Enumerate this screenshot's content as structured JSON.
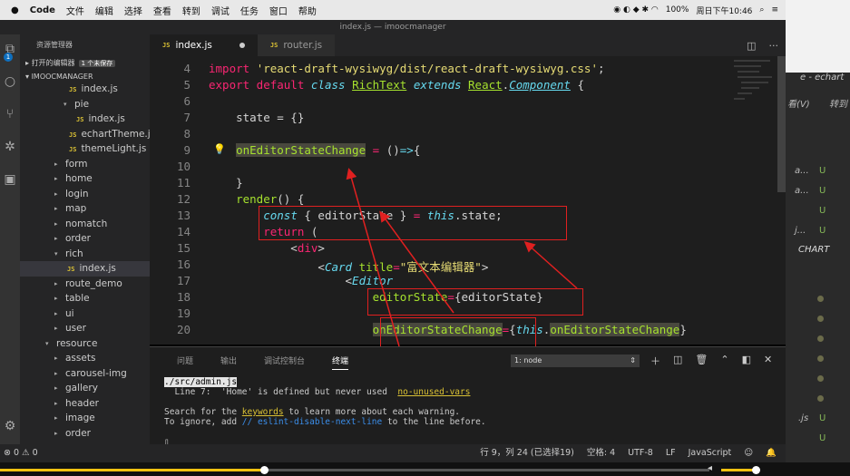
{
  "menubar": {
    "app": "Code",
    "items": [
      "文件",
      "编辑",
      "选择",
      "查看",
      "转到",
      "调试",
      "任务",
      "窗口",
      "帮助"
    ],
    "battery": "100%",
    "clock": "周日下午10:46"
  },
  "window_title": "index.js — imoocmanager",
  "sidebar": {
    "header": "资源管理器",
    "open_editors": "打开的编辑器",
    "unsaved_badge": "1 个未保存",
    "project": "IMOOCMANAGER",
    "badge_count": "1",
    "tree": [
      {
        "label": "index.js",
        "type": "js",
        "indent": 60
      },
      {
        "label": "pie",
        "type": "folder-open",
        "indent": 60
      },
      {
        "label": "index.js",
        "type": "js",
        "indent": 68
      },
      {
        "label": "echartTheme.js",
        "type": "js",
        "indent": 60
      },
      {
        "label": "themeLight.js",
        "type": "js",
        "indent": 60
      },
      {
        "label": "form",
        "type": "folder",
        "indent": 50
      },
      {
        "label": "home",
        "type": "folder",
        "indent": 50
      },
      {
        "label": "login",
        "type": "folder",
        "indent": 50
      },
      {
        "label": "map",
        "type": "folder",
        "indent": 50
      },
      {
        "label": "nomatch",
        "type": "folder",
        "indent": 50
      },
      {
        "label": "order",
        "type": "folder",
        "indent": 50
      },
      {
        "label": "rich",
        "type": "folder-open",
        "indent": 50
      },
      {
        "label": "index.js",
        "type": "js",
        "indent": 58,
        "selected": true
      },
      {
        "label": "route_demo",
        "type": "folder",
        "indent": 50
      },
      {
        "label": "table",
        "type": "folder",
        "indent": 50
      },
      {
        "label": "ui",
        "type": "folder",
        "indent": 50
      },
      {
        "label": "user",
        "type": "folder",
        "indent": 50
      },
      {
        "label": "resource",
        "type": "folder-open",
        "indent": 40
      },
      {
        "label": "assets",
        "type": "folder",
        "indent": 50
      },
      {
        "label": "carousel-img",
        "type": "folder",
        "indent": 50
      },
      {
        "label": "gallery",
        "type": "folder",
        "indent": 50
      },
      {
        "label": "header",
        "type": "folder",
        "indent": 50
      },
      {
        "label": "image",
        "type": "folder",
        "indent": 50
      },
      {
        "label": "order",
        "type": "folder",
        "indent": 50
      }
    ]
  },
  "tabs": [
    {
      "label": "index.js",
      "active": true,
      "dirty": true
    },
    {
      "label": "router.js",
      "active": false
    }
  ],
  "editor": {
    "lines": [
      {
        "n": "4",
        "html": "<span class=\"kw\">import</span> <span class=\"st\">'react-draft-wysiwyg/dist/react-draft-wysiwyg.css'</span>;"
      },
      {
        "n": "5",
        "html": "<span class=\"kw\">export default</span> <span class=\"it\">class</span> <span class=\"cls\">RichText</span> <span class=\"it\">extends</span> <span class=\"cls\">React</span>.<span class=\"cls it\">Component</span> {"
      },
      {
        "n": "6",
        "html": ""
      },
      {
        "n": "7",
        "html": "    state = {}"
      },
      {
        "n": "8",
        "html": ""
      },
      {
        "n": "9",
        "html": "    <span class=\"fn hl\">onEditorStateChange</span> <span class=\"kw\">=</span> ()<span class=\"it\">=&gt;</span>{"
      },
      {
        "n": "10",
        "html": ""
      },
      {
        "n": "11",
        "html": "    }"
      },
      {
        "n": "12",
        "html": "    <span class=\"fn\">render</span>() {"
      },
      {
        "n": "13",
        "html": "        <span class=\"it\">const</span> { editorState } <span class=\"kw\">=</span> <span class=\"it\">this</span>.state;"
      },
      {
        "n": "14",
        "html": "        <span class=\"kw\">return</span> ("
      },
      {
        "n": "15",
        "html": "            &lt;<span class=\"tg\">div</span>&gt;"
      },
      {
        "n": "16",
        "html": "                &lt;<span class=\"it\">Card</span> <span class=\"at\">title</span><span class=\"kw\">=</span><span class=\"st\">\"富文本编辑器\"</span>&gt;"
      },
      {
        "n": "17",
        "html": "                    &lt;<span class=\"it\">Editor</span>"
      },
      {
        "n": "18",
        "html": "                        <span class=\"at\">editorState</span><span class=\"kw\">=</span>{editorState}"
      },
      {
        "n": "19",
        "html": ""
      },
      {
        "n": "20",
        "html": "                        <span class=\"at hl\">onEditorStateChange</span><span class=\"kw\">=</span>{<span class=\"it\">this</span>.<span class=\"fn hl\">onEditorStateChange</span>}"
      }
    ]
  },
  "panel": {
    "tabs": [
      "问题",
      "输出",
      "调试控制台",
      "终端"
    ],
    "terminal_select": "1: node",
    "lines": [
      {
        "html": "<span class=\"path\">./src/admin.js</span>"
      },
      {
        "html": "  Line 7:  'Home' is defined but never used  <span class=\"u\">no-unused-vars</span>"
      },
      {
        "html": ""
      },
      {
        "html": "Search for the <span class=\"u\">keywords</span> to learn more about each warning."
      },
      {
        "html": "To ignore, add <span class=\"b\">// eslint-disable-next-line</span> to the line before."
      },
      {
        "html": ""
      },
      {
        "html": "▯"
      }
    ]
  },
  "status": {
    "left": "⊗ 0  ⚠ 0",
    "position": "行 9，列 24 (已选择19)",
    "spaces": "空格: 4",
    "encoding": "UTF-8",
    "eol": "LF",
    "language": "JavaScript"
  },
  "right": {
    "title": "e - echart",
    "menu1": "看(V)",
    "menu2": "转到",
    "chart": "CHART",
    "items": [
      "a...",
      "a...",
      "",
      "j...",
      "",
      "",
      ".js"
    ]
  }
}
